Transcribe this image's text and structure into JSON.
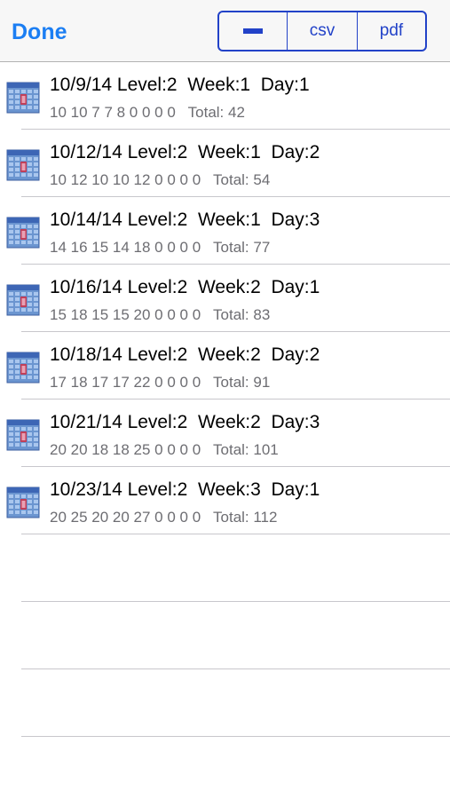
{
  "navbar": {
    "done_label": "Done",
    "segments": {
      "minus_icon": "minus-icon",
      "csv_label": "csv",
      "pdf_label": "pdf"
    }
  },
  "colors": {
    "accent_blue": "#1b7ef3",
    "segment_blue": "#2242c8",
    "subtitle_gray": "#6d6d72",
    "separator": "#c8c7cc"
  },
  "rows": [
    {
      "icon": "calendar-icon",
      "title": "10/9/14 Level:2  Week:1  Day:1",
      "subtitle": "10 10 7 7 8 0 0 0 0   Total: 42"
    },
    {
      "icon": "calendar-icon",
      "title": "10/12/14 Level:2  Week:1  Day:2",
      "subtitle": "10 12 10 10 12 0 0 0 0   Total: 54"
    },
    {
      "icon": "calendar-icon",
      "title": "10/14/14 Level:2  Week:1  Day:3",
      "subtitle": "14 16 15 14 18 0 0 0 0   Total: 77"
    },
    {
      "icon": "calendar-icon",
      "title": "10/16/14 Level:2  Week:2  Day:1",
      "subtitle": "15 18 15 15 20 0 0 0 0   Total: 83"
    },
    {
      "icon": "calendar-icon",
      "title": "10/18/14 Level:2  Week:2  Day:2",
      "subtitle": "17 18 17 17 22 0 0 0 0   Total: 91"
    },
    {
      "icon": "calendar-icon",
      "title": "10/21/14 Level:2  Week:2  Day:3",
      "subtitle": "20 20 18 18 25 0 0 0 0   Total: 101"
    },
    {
      "icon": "calendar-icon",
      "title": "10/23/14 Level:2  Week:3  Day:1",
      "subtitle": "20 25 20 20 27 0 0 0 0   Total: 112"
    }
  ]
}
